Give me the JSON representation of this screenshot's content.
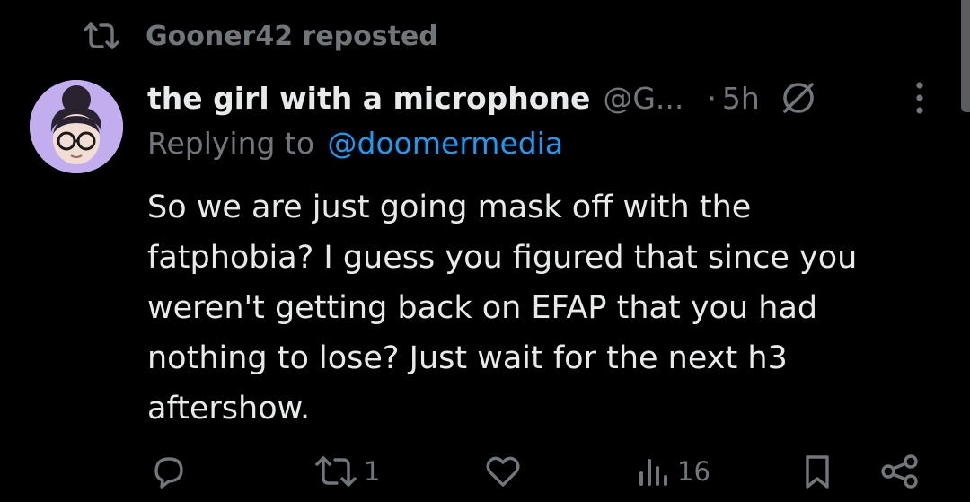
{
  "repost": {
    "text": "Gooner42 reposted",
    "icon": "repost-icon"
  },
  "tweet": {
    "avatar": "avatar",
    "display_name": "the girl with a microphone",
    "handle": "@G...",
    "separator": "·",
    "timestamp": "5h",
    "status_icon": "no-sign-icon",
    "more_icon": "more-options-icon",
    "replying_prefix": "Replying to",
    "replying_to": "@doomermedia",
    "text_lines": [
      "So we are just going mask off with the",
      "fatphobia? I guess you figured that since you",
      "weren't getting back on EFAP that you had",
      "nothing to lose? Just wait for the next h3",
      "aftershow."
    ]
  },
  "actions": {
    "reply": {
      "icon": "reply-icon",
      "count": ""
    },
    "retweet": {
      "icon": "retweet-icon",
      "count": "1"
    },
    "like": {
      "icon": "heart-icon",
      "count": ""
    },
    "views": {
      "icon": "views-icon",
      "count": "16"
    },
    "bookmark": {
      "icon": "bookmark-icon"
    },
    "share": {
      "icon": "share-icon"
    }
  },
  "colors": {
    "background": "#000000",
    "text_primary": "#e7e9ea",
    "text_secondary": "#71767b",
    "link": "#1d9bf0",
    "avatar_bg": "#c9b7f3"
  }
}
